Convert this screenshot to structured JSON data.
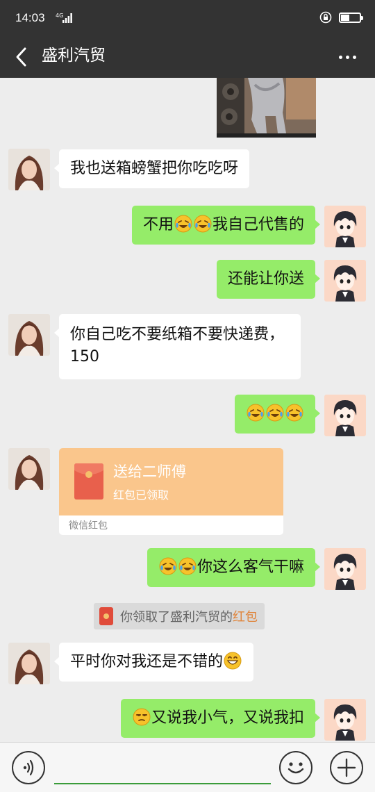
{
  "status_bar": {
    "time": "14:03",
    "network": "4G"
  },
  "header": {
    "title": "盛利汽贸"
  },
  "messages": [
    {
      "from": "contact",
      "text": "我也送箱螃蟹把你吃吃呀"
    },
    {
      "from": "me",
      "text": "不用",
      "emoji": [
        "crying-laughing-emoji",
        "crying-laughing-emoji"
      ],
      "text_after": "我自己代售的"
    },
    {
      "from": "me",
      "text": "还能让你送"
    },
    {
      "from": "contact",
      "line1": "你自己吃不要纸箱不要快递费，",
      "line2": "150"
    },
    {
      "from": "me",
      "emoji": [
        "crying-laughing-emoji",
        "crying-laughing-emoji",
        "crying-laughing-emoji"
      ]
    },
    {
      "from": "contact",
      "type": "red-packet",
      "title": "送给二师傅",
      "status": "红包已领取",
      "footer": "微信红包"
    },
    {
      "from": "me",
      "emoji": [
        "crying-laughing-emoji",
        "crying-laughing-emoji"
      ],
      "text_after": "你这么客气干嘛"
    },
    {
      "from": "system",
      "text": "你领取了盛利汽贸的",
      "link": "红包"
    },
    {
      "from": "contact",
      "text": "平时你对我还是不错的",
      "emoji": [
        "grinning-emoji"
      ]
    },
    {
      "from": "me",
      "emoji": [
        "unamused-emoji"
      ],
      "text_after": "又说我小气，又说我扣"
    }
  ],
  "colors": {
    "header_bg": "#333333",
    "chat_bg": "#ededed",
    "outgoing_bubble": "#95ec69",
    "incoming_bubble": "#ffffff",
    "red_packet": "#fac68c",
    "link": "#e0843a"
  },
  "battery_level": 0.45
}
